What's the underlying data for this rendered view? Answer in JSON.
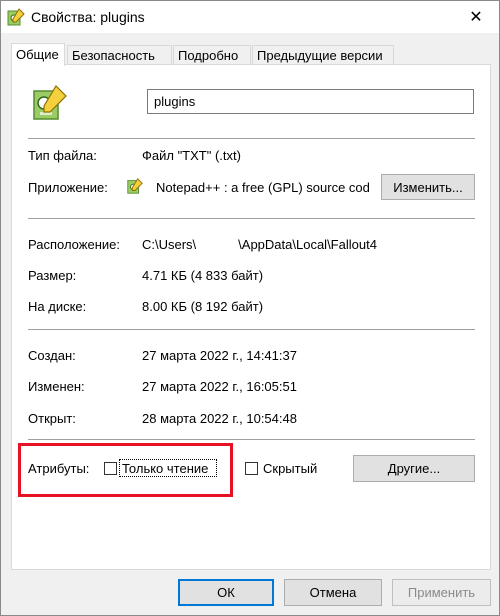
{
  "window": {
    "title": "Свойства: plugins",
    "close_glyph": "✕"
  },
  "tabs": [
    {
      "label": "Общие",
      "active": true
    },
    {
      "label": "Безопасность"
    },
    {
      "label": "Подробно"
    },
    {
      "label": "Предыдущие версии"
    }
  ],
  "general": {
    "file_name": "plugins",
    "file_type_label": "Тип файла:",
    "file_type_value": "Файл \"TXT\" (.txt)",
    "app_label": "Приложение:",
    "app_value": "Notepad++ : a free (GPL) source cod",
    "change_button": "Изменить...",
    "location_label": "Расположение:",
    "location_value_prefix": "C:\\Users\\",
    "location_value_suffix": "\\AppData\\Local\\Fallout4",
    "size_label": "Размер:",
    "size_value": "4.71 КБ (4 833 байт)",
    "disk_label": "На диске:",
    "disk_value": "8.00 КБ (8 192 байт)",
    "created_label": "Создан:",
    "created_value": "27 марта 2022 г., 14:41:37",
    "modified_label": "Изменен:",
    "modified_value": "27 марта 2022 г., 16:05:51",
    "opened_label": "Открыт:",
    "opened_value": "28 марта 2022 г., 10:54:48",
    "attributes_label": "Атрибуты:",
    "readonly_label": "Только чтение",
    "readonly_checked": false,
    "hidden_label": "Скрытый",
    "hidden_checked": false,
    "other_button": "Другие..."
  },
  "footer": {
    "ok": "ОК",
    "cancel": "Отмена",
    "apply": "Применить"
  },
  "colors": {
    "highlight": "#e81123",
    "focus": "#0078d7"
  }
}
